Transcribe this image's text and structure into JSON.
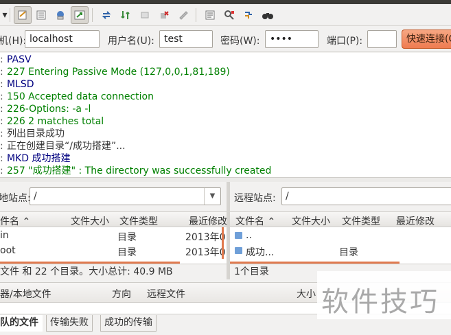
{
  "toolbar": {
    "icons": [
      "sitemanager-icon",
      "toggle-log-icon",
      "toggle-tree-icon",
      "toggle-remote-tree-icon",
      "transfer-queue-icon",
      "refresh-icon",
      "process-queue-icon",
      "cancel-icon",
      "disconnect-icon",
      "reconnect-icon",
      "filter-icon",
      "compare-icon",
      "sync-browse-icon",
      "search-icon"
    ]
  },
  "quickconnect": {
    "host_label": "机(H):",
    "host_value": "localhost",
    "user_label": "用户名(U):",
    "user_value": "test",
    "pass_label": "密码(W):",
    "pass_value": "••••",
    "port_label": "端口(P):",
    "port_value": "",
    "connect_label": "快速连接(Q"
  },
  "log": [
    {
      "text": "PASV",
      "kind": "cmd"
    },
    {
      "text": "227 Entering Passive Mode (127,0,0,1,81,189)",
      "kind": "resp"
    },
    {
      "text": "MLSD",
      "kind": "cmd"
    },
    {
      "text": "150 Accepted data connection",
      "kind": "resp"
    },
    {
      "text": "226-Options: -a -l",
      "kind": "resp"
    },
    {
      "text": "226 2 matches total",
      "kind": "resp"
    },
    {
      "text": "列出目录成功",
      "kind": "stat"
    },
    {
      "text": "正在创建目录“/成功搭建”...",
      "kind": "stat"
    },
    {
      "text": "MKD 成功搭建",
      "kind": "cmd"
    },
    {
      "text": "257 \"成功搭建\" : The directory was successfully created",
      "kind": "resp"
    }
  ],
  "local": {
    "site_label": "地站点:",
    "site_path": "/",
    "columns": [
      "件名",
      "文件大小",
      "文件类型",
      "最近修改"
    ],
    "rows": [
      {
        "name": "in",
        "size": "",
        "type": "目录",
        "modified": "2013年0"
      },
      {
        "name": "oot",
        "size": "",
        "type": "目录",
        "modified": "2013年0"
      }
    ],
    "status": "文件 和 22 个目录。大小总计: 40.9 MB"
  },
  "remote": {
    "site_label": "远程站点:",
    "site_path": "/",
    "columns": [
      "文件名",
      "文件大小",
      "文件类型",
      "最近修改"
    ],
    "rows": [
      {
        "name": "..",
        "size": "",
        "type": "",
        "modified": ""
      },
      {
        "name": "成功...",
        "size": "",
        "type": "目录",
        "modified": ""
      }
    ],
    "status": "1个目录"
  },
  "queue": {
    "columns": [
      "器/本地文件",
      "方向",
      "远程文件",
      "大小"
    ]
  },
  "tabs": {
    "queued": "队的文件",
    "failed": "传输失败",
    "success": "成功的传输"
  },
  "watermark": "软件技巧"
}
